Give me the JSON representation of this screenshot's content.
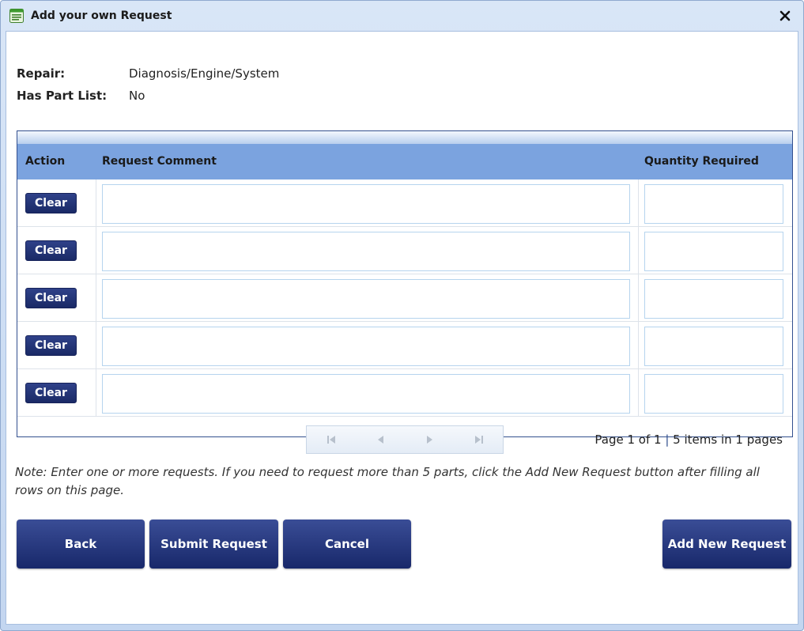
{
  "window": {
    "title": "Add your own Request",
    "close_label": "x",
    "title_icon": "form-icon"
  },
  "info": {
    "repair_label": "Repair:",
    "repair_value": "Diagnosis/Engine/System",
    "haspartlist_label": "Has Part List:",
    "haspartlist_value": "No"
  },
  "grid": {
    "columns": [
      "Action",
      "Request Comment",
      "Quantity Required"
    ],
    "rows": [
      {
        "action": "Clear",
        "comment": "",
        "quantity": ""
      },
      {
        "action": "Clear",
        "comment": "",
        "quantity": ""
      },
      {
        "action": "Clear",
        "comment": "",
        "quantity": ""
      },
      {
        "action": "Clear",
        "comment": "",
        "quantity": ""
      },
      {
        "action": "Clear",
        "comment": "",
        "quantity": ""
      }
    ],
    "pager": {
      "icons": [
        "first-page-icon",
        "prev-page-icon",
        "next-page-icon",
        "last-page-icon"
      ],
      "page_text": "Page 1 of 1",
      "separator": "|",
      "items_text": "5 items in 1 pages"
    }
  },
  "note": "Note: Enter one or more requests. If you need to request more than 5 parts, click the Add New Request button after filling all rows on this page.",
  "buttons": {
    "back": "Back",
    "submit": "Submit Request",
    "cancel": "Cancel",
    "add_new": "Add New Request"
  },
  "colors": {
    "header_bg": "#7ba3df",
    "button_bg": "#22337a",
    "grid_border": "#33508f"
  }
}
